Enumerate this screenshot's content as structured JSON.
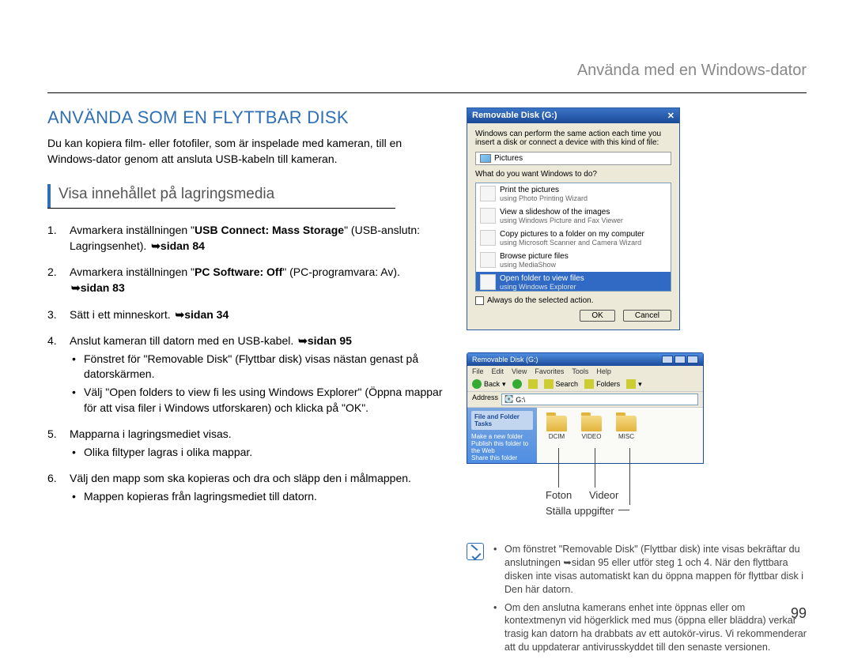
{
  "header_right": "Använda med en Windows-dator",
  "main_title": "ANVÄNDA SOM EN FLYTTBAR DISK",
  "lead": "Du kan kopiera film- eller fotofiler, som är inspelade med kameran, till en Windows-dator genom att ansluta USB-kabeln till kameran.",
  "subheading": "Visa innehållet på lagringsmedia",
  "steps": [
    {
      "num": "1.",
      "text_a": "Avmarkera inställningen \"",
      "bold": "USB Connect: Mass Storage",
      "text_b": "\" (USB-anslutn: Lagringsenhet). ",
      "ref": "➥sidan 84"
    },
    {
      "num": "2.",
      "text_a": "Avmarkera inställningen \"",
      "bold": "PC Software: Off",
      "text_b": "\" (PC-programvara: Av). ",
      "ref": "➥sidan 83"
    },
    {
      "num": "3.",
      "text_a": "Sätt i ett minneskort. ",
      "bold": "",
      "text_b": "",
      "ref": "➥sidan 34"
    },
    {
      "num": "4.",
      "text_a": "Anslut kameran till datorn med en USB-kabel. ",
      "bold": "",
      "text_b": "",
      "ref": "➥sidan 95",
      "bullets": [
        "Fönstret för \"Removable Disk\" (Flyttbar disk) visas nästan genast på datorskärmen.",
        "Välj \"Open folders to view fi les using Windows Explorer\" (Öppna mappar för att visa filer i Windows utforskaren) och klicka på \"OK\"."
      ]
    },
    {
      "num": "5.",
      "text_a": "Mapparna i lagringsmediet visas.",
      "bold": "",
      "text_b": "",
      "ref": "",
      "bullets": [
        "Olika filtyper lagras i olika mappar."
      ]
    },
    {
      "num": "6.",
      "text_a": "Välj den mapp som ska kopieras och dra och släpp den i målmappen.",
      "bold": "",
      "text_b": "",
      "ref": "",
      "bullets": [
        "Mappen kopieras från lagringsmediet till datorn."
      ]
    }
  ],
  "dialog": {
    "title": "Removable Disk (G:)",
    "intro": "Windows can perform the same action each time you insert a disk or connect a device with this kind of file:",
    "pictures_label": "Pictures",
    "question": "What do you want Windows to do?",
    "actions": [
      {
        "title": "Print the pictures",
        "sub": "using Photo Printing Wizard"
      },
      {
        "title": "View a slideshow of the images",
        "sub": "using Windows Picture and Fax Viewer"
      },
      {
        "title": "Copy pictures to a folder on my computer",
        "sub": "using Microsoft Scanner and Camera Wizard"
      },
      {
        "title": "Browse picture files",
        "sub": "using MediaShow"
      },
      {
        "title": "Open folder to view files",
        "sub": "using Windows Explorer",
        "selected": true
      }
    ],
    "always": "Always do the selected action.",
    "ok": "OK",
    "cancel": "Cancel"
  },
  "explorer": {
    "title": "Removable Disk (G:)",
    "menu": [
      "File",
      "Edit",
      "View",
      "Favorites",
      "Tools",
      "Help"
    ],
    "toolbar_back": "Back",
    "toolbar_search": "Search",
    "toolbar_folders": "Folders",
    "address_label": "Address",
    "address_value": "G:\\",
    "side_block_title": "File and Folder Tasks",
    "side_items": [
      "Make a new folder",
      "Publish this folder to the Web",
      "Share this folder"
    ],
    "folders": [
      "DCIM",
      "VIDEO",
      "MISC"
    ]
  },
  "callouts": {
    "foton": "Foton",
    "videor": "Videor",
    "uppgifter": "Ställa uppgifter"
  },
  "notes": [
    "Om fönstret \"Removable Disk\" (Flyttbar disk) inte visas bekräftar du anslutningen ➥sidan 95 eller utför steg 1 och 4. När den flyttbara disken inte visas automatiskt kan du öppna mappen för flyttbar disk i Den här datorn.",
    "Om den anslutna kamerans enhet inte öppnas eller om kontextmenyn vid högerklick med mus (öppna eller bläddra) verkar trasig kan datorn ha drabbats av ett autokör-virus. Vi rekommenderar att du uppdaterar antivirusskyddet till den senaste versionen."
  ],
  "page_number": "99"
}
